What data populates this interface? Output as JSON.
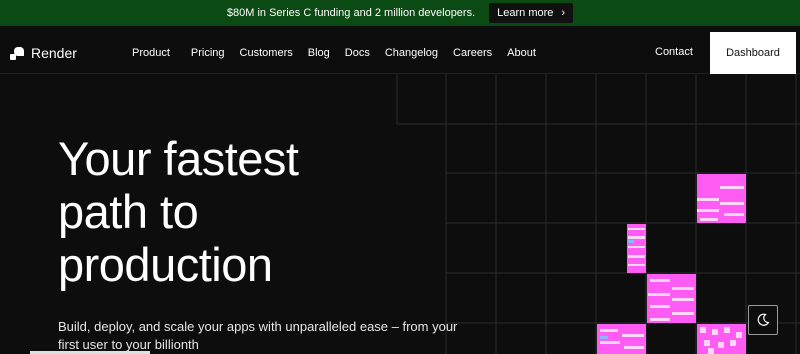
{
  "banner": {
    "text": "$80M in Series C funding and 2 million developers.",
    "cta_label": "Learn more",
    "cta_icon": "chevron-right-icon"
  },
  "nav": {
    "logo_text": "Render",
    "links": [
      "Product",
      "Pricing",
      "Customers",
      "Blog",
      "Docs",
      "Changelog",
      "Careers",
      "About"
    ],
    "contact_label": "Contact",
    "dashboard_label": "Dashboard"
  },
  "hero": {
    "title": "Your fastest\npath to\nproduction",
    "subtitle": "Build, deploy, and scale your apps with unparalleled ease – from your first user to your billionth"
  },
  "theme_toggle": {
    "icon": "moon-icon"
  },
  "colors": {
    "banner_bg": "#0b4a12",
    "page_bg": "#0d0d0d",
    "accent_magenta": "#ff5cf4",
    "grid_line": "#2a2a2a"
  }
}
